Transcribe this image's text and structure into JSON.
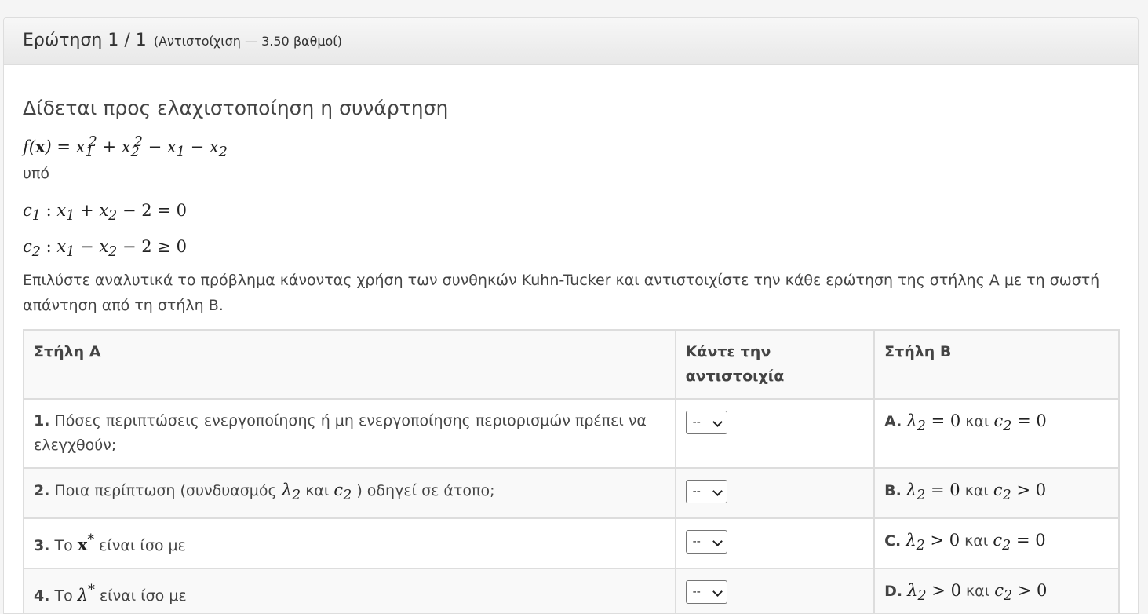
{
  "header": {
    "title": "Ερώτηση 1 / 1",
    "meta": "(Αντιστοίχιση — 3.50 βαθμοί)"
  },
  "question": {
    "intro": "Δίδεται προς ελαχιστοποίηση η συνάρτηση",
    "upo": "υπό",
    "instructions": "Επιλύστε αναλυτικά το πρόβλημα κάνοντας χρήση των συνθηκών Kuhn-Tucker και αντιστοιχίστε την κάθε ερώτηση της στήλης Α με τη σωστή απάντηση από τη στήλη Β."
  },
  "table": {
    "headers": [
      "Στήλη Α",
      "Κάντε την αντιστοιχία",
      "Στήλη Β"
    ],
    "rows": [
      {
        "num": "1.",
        "text": "Πόσες περιπτώσεις ενεργοποίησης ή μη ενεργοποίησης περιορισμών πρέπει να ελεγχθούν;",
        "select": "--",
        "letter": "A.",
        "connector": "και"
      },
      {
        "num": "2.",
        "text_before": "Ποια περίπτωση (συνδυασμός",
        "text_mid": "και",
        "text_after": ") οδηγεί σε άτοπο;",
        "select": "--",
        "letter": "B.",
        "connector": "και"
      },
      {
        "num": "3.",
        "text_before": "Το",
        "text_after": "είναι ίσο με",
        "select": "--",
        "letter": "C.",
        "connector": "και"
      },
      {
        "num": "4.",
        "text_before": "Το",
        "text_after": "είναι ίσο με",
        "select": "--",
        "letter": "D.",
        "connector": "και"
      }
    ]
  }
}
